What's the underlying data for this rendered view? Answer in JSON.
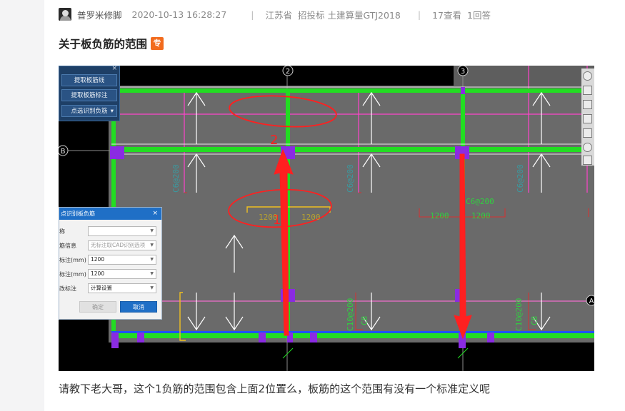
{
  "meta": {
    "author": "普罗米修脚",
    "datetime": "2020-10-13 16:28:27",
    "separator": "|",
    "region": "江苏省",
    "category": "招投标 土建算量GTJ2018",
    "views": "17查看",
    "answers": "1回答"
  },
  "post": {
    "title": "关于板负筋的范围",
    "badge": "专",
    "question": "请教下老大哥，这个1负筋的范围包含上面2位置么，板筋的这个范围有没有一个标准定义呢"
  },
  "cad": {
    "panel": {
      "close": "×",
      "buttons": [
        "提取板筋线",
        "提取板筋标注",
        "点选识别负筋"
      ],
      "dropdown_arrow": "▾"
    },
    "dialog": {
      "title": "点识别板负筋",
      "close": "×",
      "rows": [
        {
          "label": "称",
          "value": ""
        },
        {
          "label": "筋信息",
          "value": "无标注取CAD识别选项"
        },
        {
          "label": "标注(mm)",
          "value": "1200"
        },
        {
          "label": "标注(mm)",
          "value": "1200"
        },
        {
          "label": "改标注",
          "value": "计算设置"
        }
      ],
      "ok": "确定",
      "cancel": "取消"
    },
    "grid_labels": {
      "axis_2": "2",
      "axis_3": "3",
      "axis_B": "B",
      "axis_A": "A"
    },
    "annotations": {
      "num_1": "1",
      "num_2": "2"
    },
    "rebar_texts": {
      "c6_200": "C6@200",
      "dim_1200": "1200",
      "c10_200": "C10@200",
      "c8": "C8"
    },
    "colors": {
      "beam": "#22dd22",
      "rebar_pink": "#ff44cc",
      "arrow_red": "#ff2020",
      "column": "#8a2be2",
      "grid_line": "#5a5a5a"
    }
  }
}
